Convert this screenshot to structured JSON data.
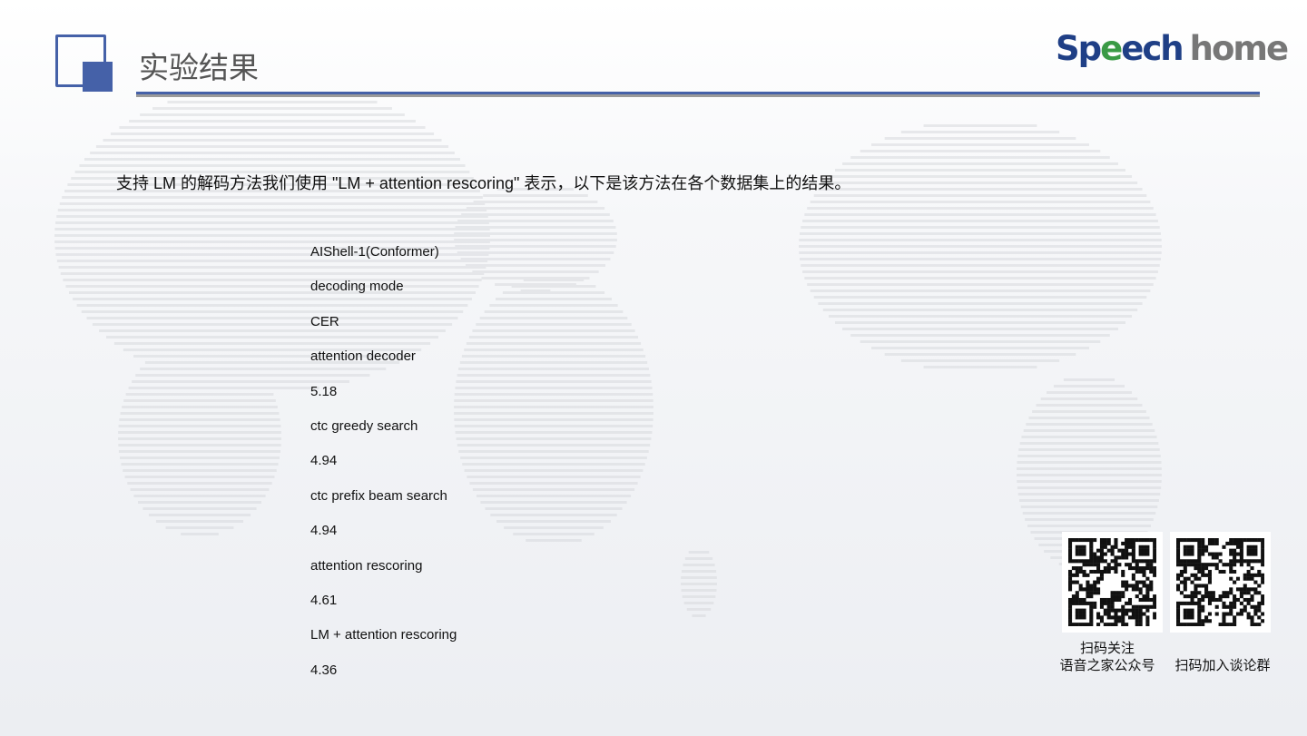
{
  "header": {
    "title": "实验结果",
    "logo_text": "Speechhome"
  },
  "intro": "支持 LM 的解码方法我们使用  \"LM + attention rescoring\" 表示，以下是该方法在各个数据集上的结果。",
  "results": {
    "dataset": "AIShell-1(Conformer)",
    "col_mode": "decoding mode",
    "col_metric": "CER",
    "rows": [
      {
        "mode": "attention decoder",
        "cer": "5.18"
      },
      {
        "mode": "ctc greedy search",
        "cer": "4.94"
      },
      {
        "mode": "ctc prefix beam search",
        "cer": "4.94"
      },
      {
        "mode": "attention rescoring",
        "cer": "4.61"
      },
      {
        "mode": "LM + attention rescoring",
        "cer": "4.36"
      }
    ]
  },
  "qr": {
    "left_caption_1": "扫码关注",
    "left_caption_2": "语音之家公众号",
    "right_caption": "扫码加入谈论群"
  },
  "colors": {
    "accent": "#4561a8",
    "logo_blue": "#1f3f86",
    "logo_green": "#3a9a45",
    "logo_gray": "#777777"
  }
}
